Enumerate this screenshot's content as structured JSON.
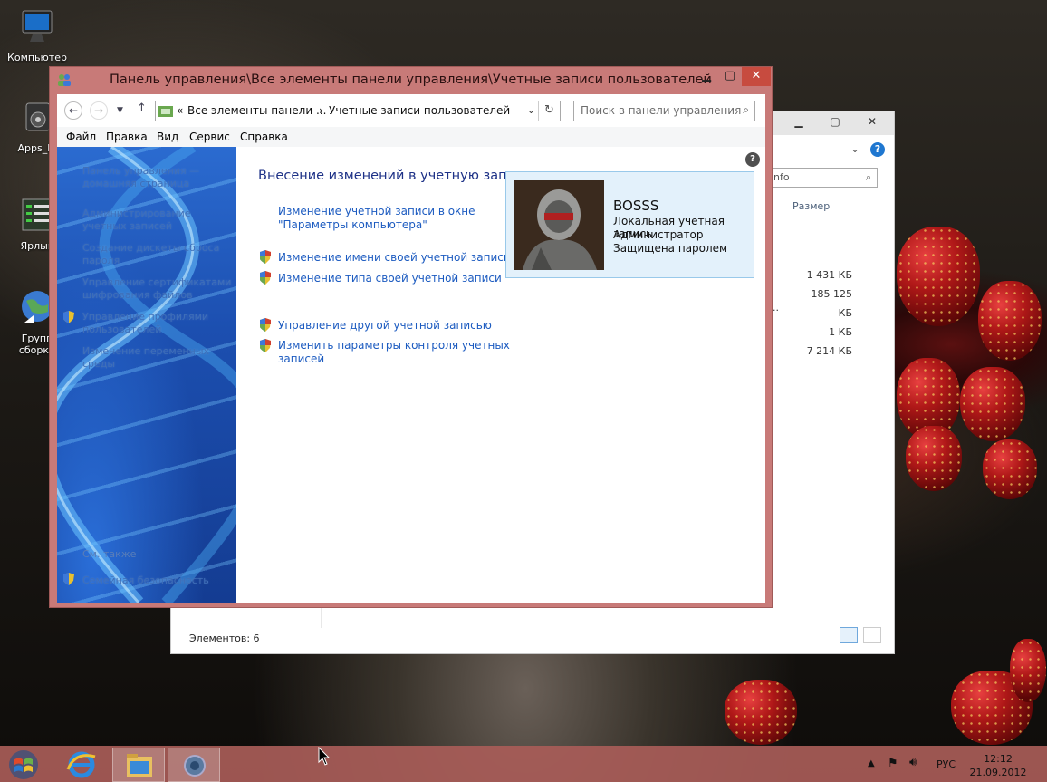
{
  "desktop": {
    "icons": [
      {
        "label": "Компьютер"
      },
      {
        "label": "Apps_In"
      },
      {
        "label": "Ярлык"
      },
      {
        "label": "Групп сборки"
      }
    ]
  },
  "explorer": {
    "search_fragment": "nfo",
    "column_size": "Размер",
    "sizes": [
      "1 431 КБ",
      "185 125 КБ",
      "1 КБ",
      "7 214 КБ"
    ],
    "row_fragment": "..",
    "status": "Элементов: 6",
    "help": "?"
  },
  "control_panel": {
    "title": "Панель управления\\Все элементы панели управления\\Учетные записи пользователей",
    "address": {
      "prefix": "«",
      "crumb1": "Все элементы панели ...",
      "separator": "›",
      "crumb2": "Учетные записи пользователей"
    },
    "search_placeholder": "Поиск в панели управления",
    "menu": [
      "Файл",
      "Правка",
      "Вид",
      "Сервис",
      "Справка"
    ],
    "sidebar": {
      "links": [
        "Панель управления — домашняя страница",
        "Администрирование учетных записей",
        "Создание дискеты сброса пароля",
        "Управление сертификатами шифрования файлов",
        "Управление профилями пользователей",
        "Изменение переменных среды"
      ],
      "see_also": "См. также",
      "family_safety": "Семейная безопасность"
    },
    "heading": "Внесение изменений в учетную запись пользователя",
    "tasks": {
      "pc_settings_1": "Изменение учетной записи в окне",
      "pc_settings_2": "\"Параметры компьютера\"",
      "rename": "Изменение имени своей учетной записи",
      "change_type": "Изменение типа своей учетной записи",
      "manage_other": "Управление другой учетной записью",
      "uac_1": "Изменить параметры контроля учетных",
      "uac_2": "записей"
    },
    "user": {
      "name": "BOSSS",
      "line1": "Локальная учетная запись",
      "line2": "Администратор",
      "line3": "Защищена паролем"
    },
    "help": "?"
  },
  "taskbar": {
    "language": "РУС",
    "time": "12:12",
    "date": "21.09.2012"
  },
  "colors": {
    "window_frame": "#c87a78",
    "close_button": "#c74b3f",
    "link": "#1c5bc0",
    "heading": "#1e3287",
    "user_card_bg": "#e3f1fb",
    "taskbar": "#a85c58"
  }
}
